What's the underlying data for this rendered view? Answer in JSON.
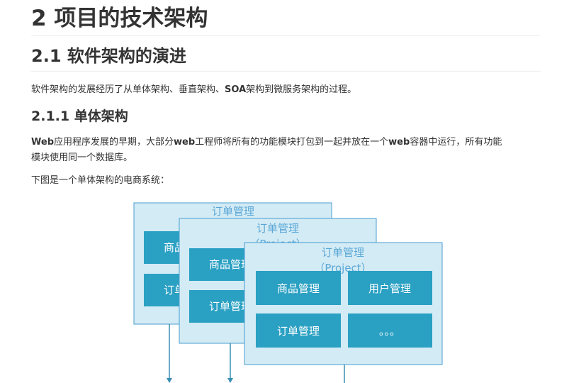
{
  "heading1": "2 项目的技术架构",
  "heading2": "2.1 软件架构的演进",
  "para_evolution": {
    "a": "软件架构的发展经历了从单体架构、垂直架构、",
    "b": "SOA",
    "c": "架构到微服务架构的过程。"
  },
  "heading3": "2.1.1 单体架构",
  "para_monolith": {
    "w1": "Web",
    "t1": "应用程序发展的早期，大部分",
    "w2": "web",
    "t2": "工程师将所有的功能模块打包到一起并放在一个",
    "w3": "web",
    "t3": "容器中运行，所有功能",
    "line2": "模块使用同一个数据库。"
  },
  "para_figure_intro": "下图是一个单体架构的电商系统：",
  "diagram": {
    "colors": {
      "panel_fill": "#d3ebf5",
      "panel_border": "#4a9ed0",
      "module_fill": "#2aa0c3",
      "title_text": "#5aa7d6",
      "module_text": "#ffffff"
    },
    "panels": [
      {
        "title": "订单管理",
        "subtitle": "",
        "modules": [
          "商品管理",
          "订单管理"
        ]
      },
      {
        "title": "订单管理",
        "subtitle": "（Project）",
        "modules": [
          "商品管理",
          "订单管理"
        ]
      },
      {
        "title": "订单管理",
        "subtitle": "（Project）",
        "modules": [
          "商品管理",
          "用户管理",
          "订单管理",
          "。。。"
        ]
      }
    ]
  }
}
